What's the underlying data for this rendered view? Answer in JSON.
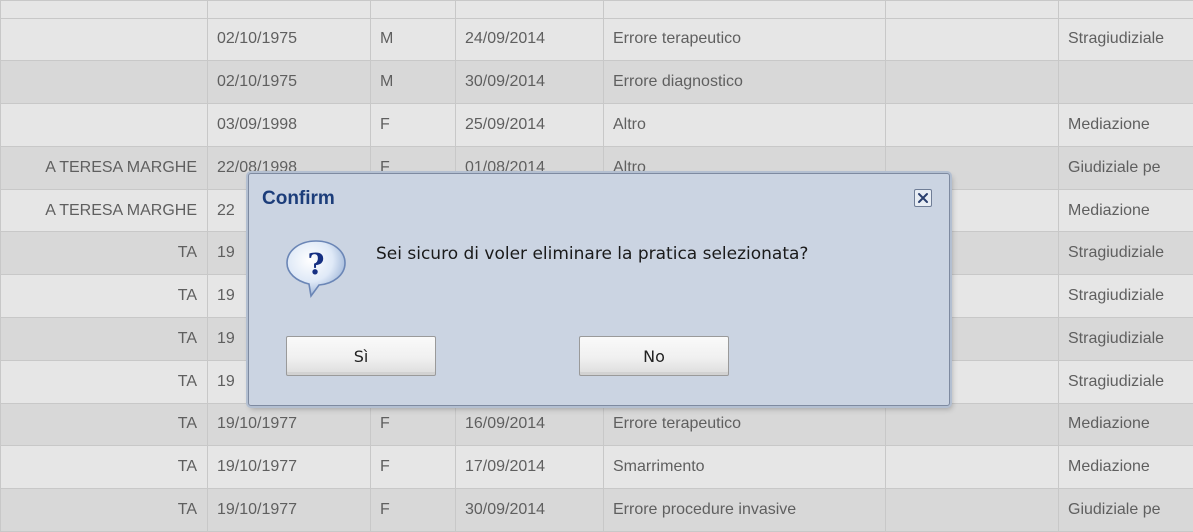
{
  "table": {
    "rows": [
      [
        "",
        "",
        "",
        "",
        "",
        "",
        ""
      ],
      [
        "",
        "02/10/1975",
        "M",
        "24/09/2014",
        "Errore terapeutico",
        "",
        "Stragiudiziale"
      ],
      [
        "",
        "02/10/1975",
        "M",
        "30/09/2014",
        "Errore diagnostico",
        "",
        ""
      ],
      [
        "",
        "03/09/1998",
        "F",
        "25/09/2014",
        "Altro",
        "",
        "Mediazione"
      ],
      [
        "A TERESA MARGHE",
        "22/08/1998",
        "F",
        "01/08/2014",
        "Altro",
        "",
        "Giudiziale pe"
      ],
      [
        "A TERESA MARGHE",
        "22",
        "",
        "",
        "",
        "",
        "Mediazione"
      ],
      [
        "TA",
        "19",
        "",
        "",
        "",
        "",
        "Stragiudiziale"
      ],
      [
        "TA",
        "19",
        "",
        "",
        "",
        "",
        "Stragiudiziale"
      ],
      [
        "TA",
        "19",
        "",
        "",
        "",
        "",
        "Stragiudiziale"
      ],
      [
        "TA",
        "19",
        "",
        "",
        "",
        "",
        "Stragiudiziale"
      ],
      [
        "TA",
        "19/10/1977",
        "F",
        "16/09/2014",
        "Errore terapeutico",
        "",
        "Mediazione"
      ],
      [
        "TA",
        "19/10/1977",
        "F",
        "17/09/2014",
        "Smarrimento",
        "",
        "Mediazione"
      ],
      [
        "TA",
        "19/10/1977",
        "F",
        "30/09/2014",
        "Errore procedure invasive",
        "",
        "Giudiziale pe"
      ]
    ]
  },
  "dialog": {
    "title": "Confirm",
    "message": "Sei sicuro di voler eliminare la pratica selezionata?",
    "icon": "question-icon",
    "close_icon": "close-icon",
    "buttons": {
      "yes": "Sì",
      "no": "No"
    }
  },
  "colors": {
    "dialog_background": "#cbd4e2",
    "dialog_title": "#1c3d7a",
    "grid_text": "#5f5f5f"
  }
}
